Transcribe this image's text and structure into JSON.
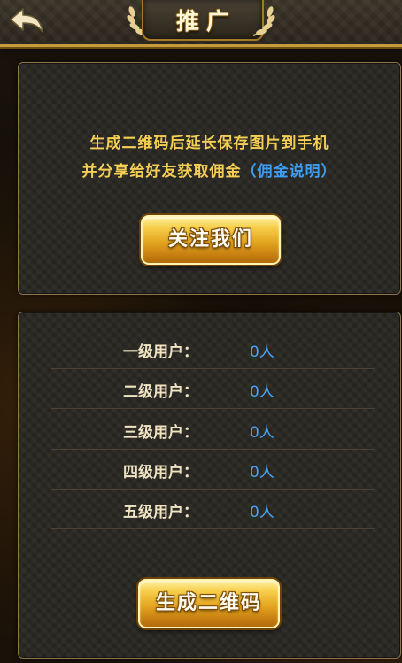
{
  "header": {
    "title": "推广",
    "back_icon": "back-arrow-icon",
    "ornament_icon": "laurel-icon"
  },
  "promo": {
    "line1": "生成二维码后延长保存图片到手机",
    "line2_text": "并分享给好友获取佣金",
    "commission_link": "（佣金说明）",
    "follow_button_label": "关注我们"
  },
  "levels": [
    {
      "label": "一级用户：",
      "value": "0人"
    },
    {
      "label": "二级用户：",
      "value": "0人"
    },
    {
      "label": "三级用户：",
      "value": "0人"
    },
    {
      "label": "四级用户：",
      "value": "0人"
    },
    {
      "label": "五级用户：",
      "value": "0人"
    }
  ],
  "generate_button_label": "生成二维码",
  "colors": {
    "accent_gold": "#f5cf54",
    "link_blue": "#3d9ef5",
    "border_gold": "#c79a3a"
  }
}
